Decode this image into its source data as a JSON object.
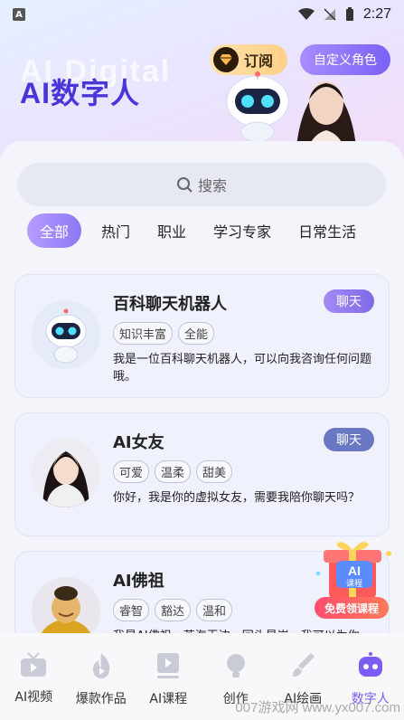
{
  "status_bar": {
    "app_icon": "A",
    "time": "2:27"
  },
  "header": {
    "watermark": "AI Digital",
    "title": "AI数字人",
    "subscribe_label": "订阅",
    "custom_role_label": "自定义角色"
  },
  "search": {
    "placeholder": "搜索"
  },
  "categories": [
    "全部",
    "热门",
    "职业",
    "学习专家",
    "日常生活"
  ],
  "cards": [
    {
      "name": "百科聊天机器人",
      "chat_label": "聊天",
      "tags": [
        "知识丰富",
        "全能"
      ],
      "desc": "我是一位百科聊天机器人，可以向我咨询任何问题哦。"
    },
    {
      "name": "AI女友",
      "chat_label": "聊天",
      "tags": [
        "可爱",
        "温柔",
        "甜美"
      ],
      "desc": "你好，我是你的虚拟女友，需要我陪你聊天吗？"
    },
    {
      "name": "AI佛祖",
      "tags": [
        "睿智",
        "豁达",
        "温和"
      ],
      "desc": "我是AI佛祖，苦海无边，回头是岸，我可以为你..."
    }
  ],
  "promo": {
    "badge": "AI",
    "sub": "课程",
    "label": "免费领课程"
  },
  "bottom_nav": [
    "AI视频",
    "爆款作品",
    "AI课程",
    "创作",
    "AI绘画",
    "数字人"
  ],
  "watermark": "007游戏网 www.yx007.com",
  "colors": {
    "accent": "#7b5cf5",
    "chat_primary": "#8b74ea",
    "chat_secondary": "#6a78c4"
  }
}
